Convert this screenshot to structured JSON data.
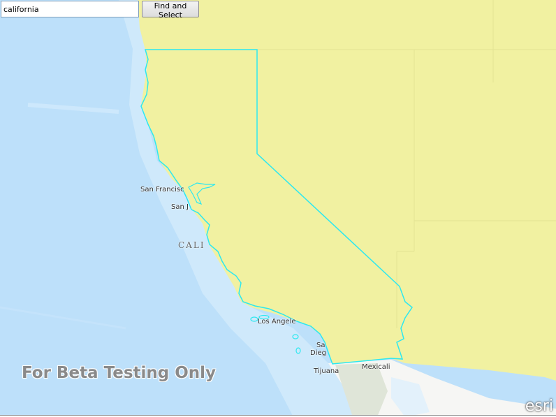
{
  "search": {
    "value": "california",
    "button_label": "Find and Select"
  },
  "map": {
    "labels": {
      "san_francisco": "San Francisc",
      "san_jose": "San J",
      "california": "CALI",
      "los_angeles": "Los Angele",
      "san_diego_1": "Sa",
      "san_diego_2": "Dieg",
      "tijuana": "Tijuana",
      "mexicali": "Mexicali"
    },
    "colors": {
      "ocean": "#bfe1fb",
      "land_selected": "#f1f1a1",
      "highlight_outline": "#2de8f0",
      "mexico_land": "#f7f7f5"
    }
  },
  "watermark": "For Beta Testing Only",
  "logo": "esri"
}
